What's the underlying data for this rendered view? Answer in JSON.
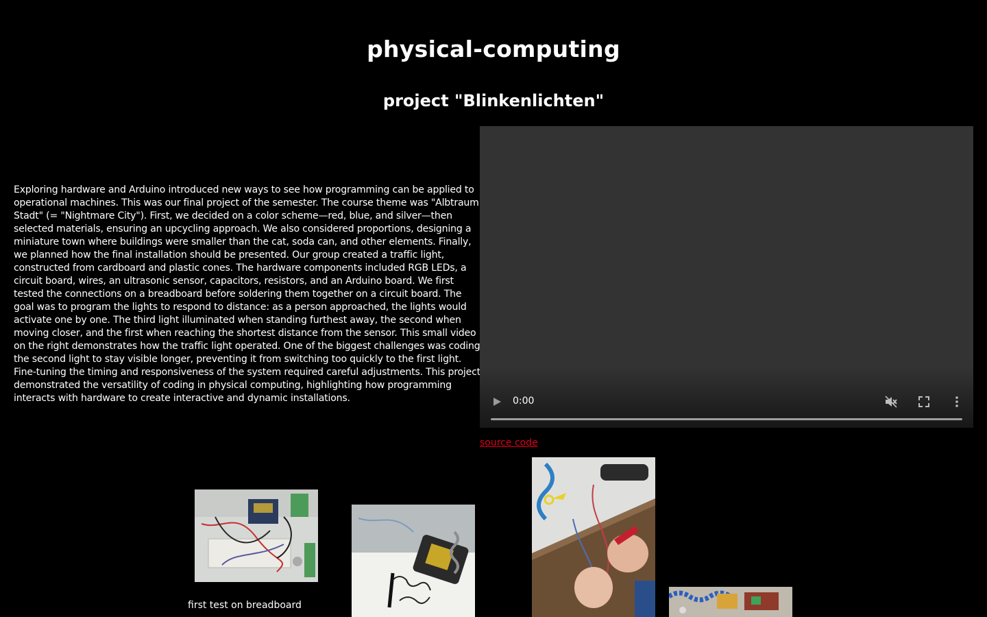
{
  "header": {
    "title": "physical-computing",
    "subtitle": "project \"Blinkenlichten\""
  },
  "description": "Exploring hardware and Arduino introduced new ways to see how programming can be applied to operational machines. This was our final project of the semester. The course theme was \"Albtraum Stadt\" (= \"Nightmare City\"). First, we decided on a color scheme—red, blue, and silver—then selected materials, ensuring an upcycling approach. We also considered proportions, designing a miniature town where buildings were smaller than the cat, soda can, and other elements. Finally, we planned how the final installation should be presented. Our group created a traffic light, constructed from cardboard and plastic cones. The hardware components included RGB LEDs, a circuit board, wires, an ultrasonic sensor, capacitors, resistors, and an Arduino board. We first tested the connections on a breadboard before soldering them together on a circuit board. The goal was to program the lights to respond to distance: as a person approached, the lights would activate one by one. The third light illuminated when standing furthest away, the second when moving closer, and the first when reaching the shortest distance from the sensor. This small video on the right demonstrates how the traffic light operated. One of the biggest challenges was coding the second light to stay visible longer, preventing it from switching too quickly to the first light. Fine-tuning the timing and responsiveness of the system required careful adjustments. This project demonstrated the versatility of coding in physical computing, highlighting how programming interacts with hardware to create interactive and dynamic installations.",
  "video": {
    "time": "0:00",
    "progress": 0,
    "muted": true,
    "icons": {
      "play": "play-icon",
      "mute": "muted-speaker-icon",
      "fullscreen": "fullscreen-icon",
      "more": "more-vertical-icon"
    }
  },
  "source_link": "source code",
  "gallery": {
    "caption_1": "first test on breadboard"
  },
  "colors": {
    "background": "#000000",
    "text": "#ffffff",
    "link": "#e0001b",
    "video_bg": "#333333"
  }
}
